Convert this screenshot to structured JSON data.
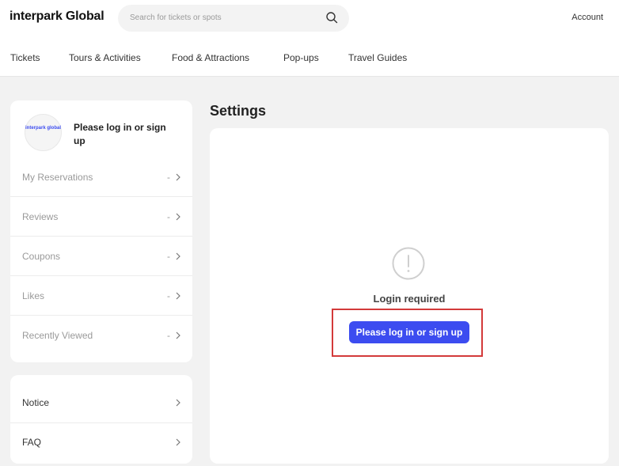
{
  "header": {
    "logo": "interpark Global",
    "search_placeholder": "Search for tickets or spots",
    "account": "Account"
  },
  "nav": [
    "Tickets",
    "Tours & Activities",
    "Food & Attractions",
    "Pop-ups",
    "Travel Guides"
  ],
  "sidebar": {
    "avatar_text": "interpark global",
    "profile_prompt": "Please log in or sign up",
    "menu": [
      {
        "label": "My Reservations",
        "value": "-"
      },
      {
        "label": "Reviews",
        "value": "-"
      },
      {
        "label": "Coupons",
        "value": "-"
      },
      {
        "label": "Likes",
        "value": "-"
      },
      {
        "label": "Recently Viewed",
        "value": "-"
      }
    ],
    "support": [
      {
        "label": "Notice"
      },
      {
        "label": "FAQ"
      }
    ]
  },
  "main": {
    "title": "Settings",
    "message": "Login required",
    "button_label": "Please log in or sign up"
  },
  "colors": {
    "accent": "#3c4cf0",
    "highlight_border": "#d33a3a"
  }
}
